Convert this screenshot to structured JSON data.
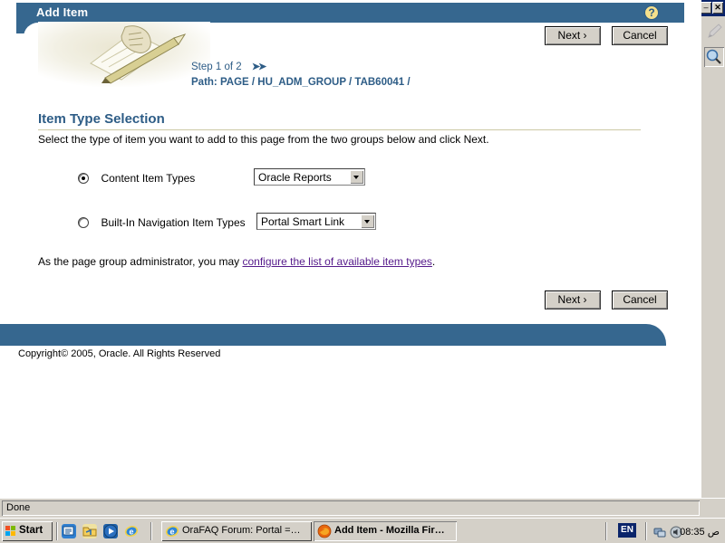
{
  "portal": {
    "title": "Add Item",
    "help_icon": "help-question-icon",
    "step_label": "Step 1 of 2",
    "step_arrows": "»",
    "path_prefix": "Path:",
    "path_segments": [
      "PAGE",
      "HU_ADM_GROUP",
      "TAB60041"
    ],
    "path_full": "Path: PAGE / HU_ADM_GROUP / TAB60041 /",
    "section_heading": "Item Type Selection",
    "instruction": "Select the type of item you want to add to this page from the two groups below and click Next.",
    "buttons": {
      "next_label": "Next ›",
      "cancel_label": "Cancel"
    },
    "options": [
      {
        "radio_label": "Content Item Types",
        "selected": true,
        "select_value": "Oracle Reports",
        "select_options": [
          "Oracle Reports"
        ]
      },
      {
        "radio_label": "Built-In Navigation Item Types",
        "selected": false,
        "select_value": "Portal Smart Link",
        "select_options": [
          "Portal Smart Link"
        ]
      }
    ],
    "admin_note_prefix": "As the page group administrator, you may ",
    "admin_note_link": "configure the list of available item types",
    "admin_note_suffix": ".",
    "copyright": "Copyright© 2005, Oracle. All Rights Reserved",
    "colors": {
      "header_blue": "#36678f",
      "link_purple": "#551a8b",
      "rule_tan": "#ccc9a5",
      "help_yellow": "#f5e08c"
    }
  },
  "right_panel": {
    "minimize_label": "–",
    "close_label": "✕",
    "tools": [
      "edit-pencil-icon",
      "search-magnifier-icon"
    ]
  },
  "statusbar": {
    "text": "Done"
  },
  "taskbar": {
    "start_label": "Start",
    "quicklaunch": [
      "show-desktop-icon",
      "media-folder-icon",
      "windows-media-player-icon",
      "internet-explorer-icon"
    ],
    "tasks": [
      {
        "label": "OraFAQ Forum: Portal =…",
        "icon": "internet-explorer-icon",
        "active": false
      },
      {
        "label": "Add Item - Mozilla Fir…",
        "icon": "firefox-icon",
        "active": true
      }
    ],
    "language": "EN",
    "tray_icons": [
      "network-icon",
      "volume-icon"
    ],
    "clock": "08:35 ص"
  }
}
